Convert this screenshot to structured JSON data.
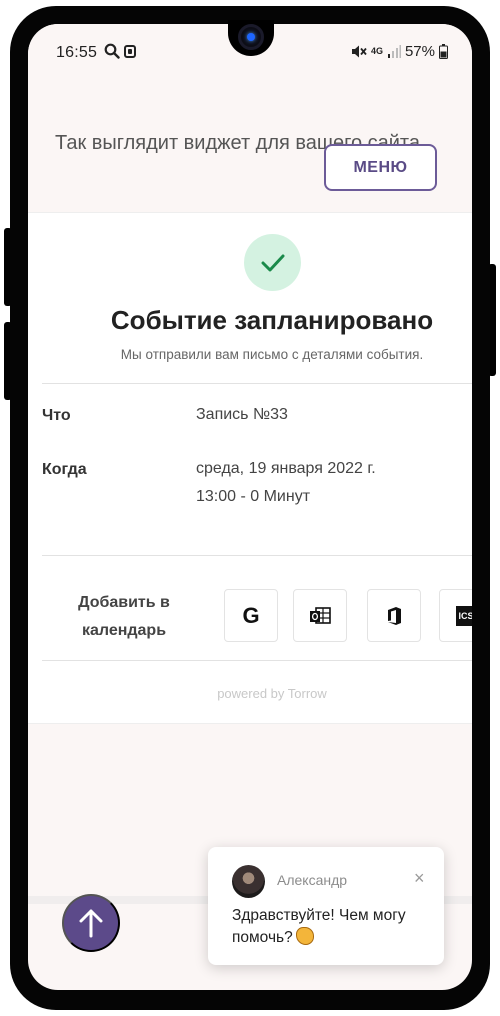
{
  "status_bar": {
    "time": "16:55",
    "network": "4G",
    "battery": "57%"
  },
  "hero": {
    "text": "Так выглядит виджет для вашего сайта"
  },
  "nav": {
    "menu_label": "МЕНЮ"
  },
  "confirmation": {
    "title": "Событие запланировано",
    "subtitle": "Мы отправили вам письмо с деталями события.",
    "details": [
      {
        "label": "Что",
        "value_line1": "Запись №33",
        "value_line2": ""
      },
      {
        "label": "Когда",
        "value_line1": "среда, 19 января 2022 г.",
        "value_line2": "13:00 - 0 Минут"
      }
    ],
    "calendar": {
      "label_line1": "Добавить в",
      "label_line2": "календарь",
      "buttons": [
        {
          "icon": "google-calendar-icon",
          "glyph": "G"
        },
        {
          "icon": "outlook-calendar-icon"
        },
        {
          "icon": "office365-calendar-icon"
        },
        {
          "icon": "ics-calendar-icon",
          "glyph": "ICS"
        }
      ]
    },
    "powered_by": "powered by Torrow"
  },
  "chat_widget": {
    "agent_name": "Александр",
    "message": "Здравствуйте! Чем могу помочь?"
  },
  "colors": {
    "accent": "#5c4a8a",
    "success_bg": "#d4f2e1",
    "success": "#1a8a4a"
  }
}
